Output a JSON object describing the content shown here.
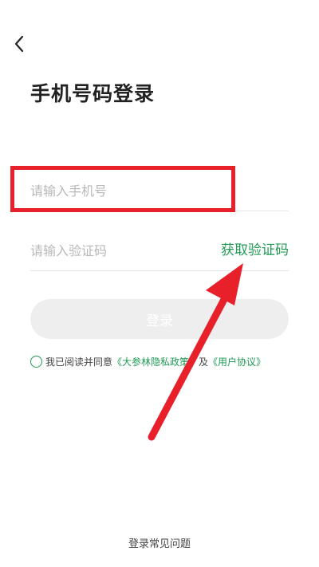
{
  "header": {
    "back_icon": "chevron-left-icon"
  },
  "page": {
    "title": "手机号码登录"
  },
  "form": {
    "phone_placeholder": "请输入手机号",
    "phone_value": "",
    "code_placeholder": "请输入验证码",
    "code_value": "",
    "get_code_label": "获取验证码",
    "login_label": "登录"
  },
  "agreement": {
    "prefix": "我已阅读并同意",
    "privacy_link": "《大参林隐私政策》",
    "and": "及",
    "terms_link": "《用户协议》"
  },
  "footer": {
    "faq_label": "登录常见问题"
  },
  "colors": {
    "accent_green": "#1f9a55",
    "annotation_red": "#e8202a",
    "button_disabled_bg": "#eeeeee",
    "placeholder_gray": "#b8b8b8"
  }
}
